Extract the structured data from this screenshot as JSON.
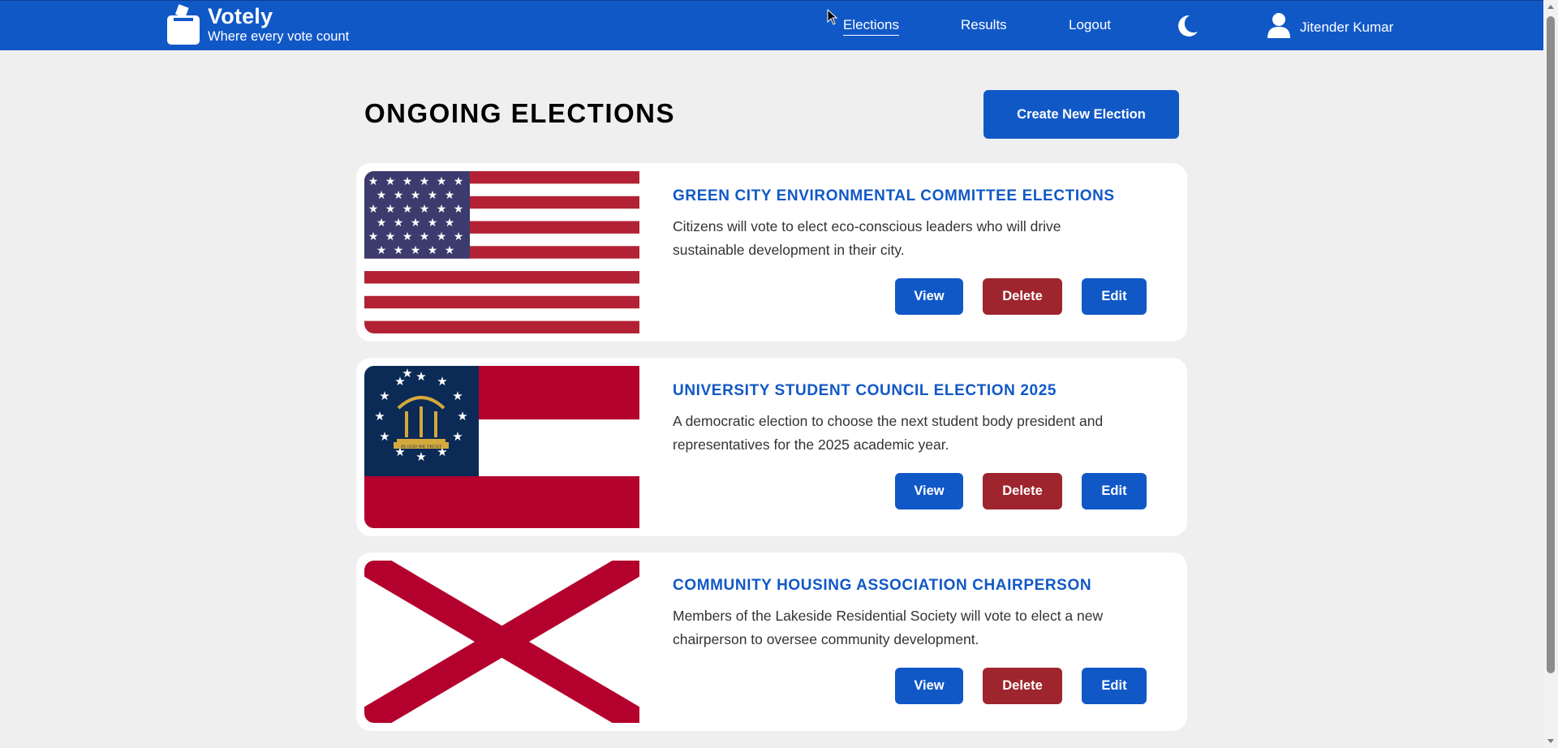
{
  "header": {
    "brand_name": "Votely",
    "brand_tagline": "Where every vote count",
    "nav": [
      {
        "label": "Elections",
        "active": true
      },
      {
        "label": "Results",
        "active": false
      },
      {
        "label": "Logout",
        "active": false
      }
    ],
    "theme_icon": "moon-icon",
    "user_icon": "user-icon",
    "user_name": "Jitender Kumar"
  },
  "main": {
    "title": "ONGOING ELECTIONS",
    "create_button_label": "Create New Election",
    "elections": [
      {
        "title": "GREEN CITY ENVIRONMENTAL COMMITTEE ELECTIONS",
        "description": "Citizens will vote to elect eco-conscious leaders who will drive sustainable development in their city.",
        "flag": "usa-flag"
      },
      {
        "title": "UNIVERSITY STUDENT COUNCIL ELECTION 2025",
        "description": "A democratic election to choose the next student body president and representatives for the 2025 academic year.",
        "flag": "georgia-flag",
        "flag_text": "IN GOD WE TRUST"
      },
      {
        "title": "COMMUNITY HOUSING ASSOCIATION CHAIRPERSON",
        "description": "Members of the Lakeside Residential Society will vote to elect a new chairperson to oversee community development.",
        "flag": "alabama-flag"
      }
    ],
    "actions": {
      "view": "View",
      "delete": "Delete",
      "edit": "Edit"
    }
  },
  "colors": {
    "primary": "#1158c7",
    "danger": "#9e252d",
    "background": "#efefef"
  }
}
